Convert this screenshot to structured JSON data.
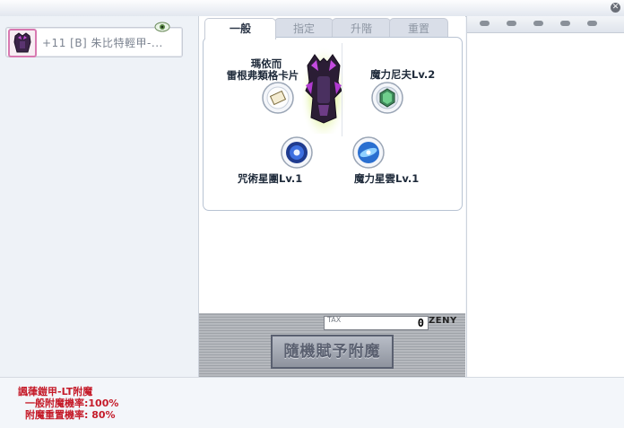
{
  "window": {
    "close_icon": "close-icon"
  },
  "item": {
    "name": "+11 [B] 朱比特輕甲-...",
    "thumb_icon": "armor-thumbnail-icon",
    "badge_icon": "view-eye-icon"
  },
  "tabs": [
    {
      "label": "一般",
      "active": true
    },
    {
      "label": "指定",
      "active": false
    },
    {
      "label": "升階",
      "active": false
    },
    {
      "label": "重置",
      "active": false
    }
  ],
  "slots": {
    "card": {
      "label_line1": "瑪依而",
      "label_line2": "雷根弗類格卡片",
      "icon": "card-icon"
    },
    "slot2": {
      "label": "魔力尼夫Lv.2",
      "icon": "green-gem-orb-icon"
    },
    "slot3": {
      "label": "咒術星團Lv.1",
      "icon": "blue-star-cluster-orb-icon"
    },
    "slot4": {
      "label": "魔力星雲Lv.1",
      "icon": "blue-nebula-orb-icon"
    }
  },
  "armor_icon": "purple-armor-icon",
  "tax": {
    "label": "TAX",
    "value": "0",
    "currency": "ZENY"
  },
  "enchant_button": {
    "label": "隨機賦予附魔"
  },
  "info": {
    "title": "諷葎鎧甲-LT附魔",
    "line1": "一般附魔機率:100%",
    "line2": "附魔重置機率: 80%"
  },
  "colors": {
    "accent_red": "#c51c2a",
    "tab_active": "#ffffff",
    "panel_border": "#b8c3d3"
  }
}
